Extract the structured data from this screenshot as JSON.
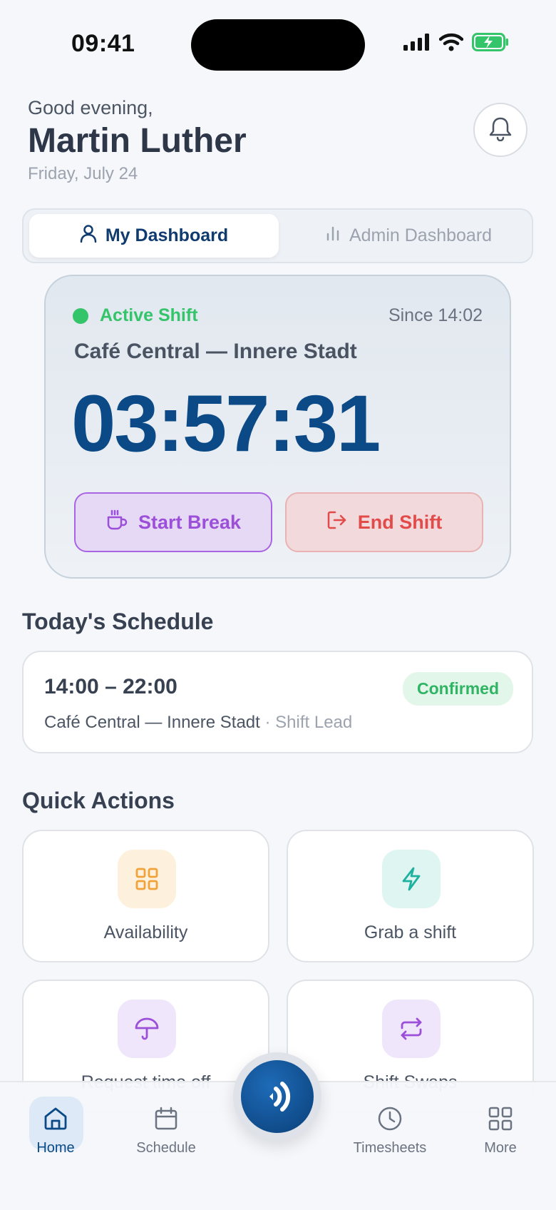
{
  "status": {
    "time": "09:41"
  },
  "header": {
    "greeting": "Good evening,",
    "name": "Martin Luther",
    "date": "Friday, July 24"
  },
  "tabs": {
    "my_dashboard": "My Dashboard",
    "admin_dashboard": "Admin Dashboard"
  },
  "active_shift": {
    "status": "Active Shift",
    "since": "Since 14:02",
    "location": "Café Central — Innere Stadt",
    "timer": "03:57:31",
    "start_break": "Start Break",
    "end_shift": "End Shift"
  },
  "schedule": {
    "title": "Today's Schedule",
    "time": "14:00 – 22:00",
    "badge": "Confirmed",
    "location": "Café Central — Innere Stadt",
    "role": " · Shift Lead"
  },
  "quick_actions": {
    "title": "Quick Actions",
    "items": [
      {
        "label": "Availability",
        "icon": "grid-icon"
      },
      {
        "label": "Grab a shift",
        "icon": "lightning-icon"
      },
      {
        "label": "Request time off",
        "icon": "umbrella-icon"
      },
      {
        "label": "Shift Swaps",
        "icon": "swap-icon"
      }
    ]
  },
  "nav": {
    "home": "Home",
    "schedule": "Schedule",
    "timesheets": "Timesheets",
    "more": "More"
  },
  "colors": {
    "primary": "#0b4a86",
    "active_green": "#34c46a",
    "break_purple": "#9c4fd9",
    "end_red": "#e34b4b"
  }
}
